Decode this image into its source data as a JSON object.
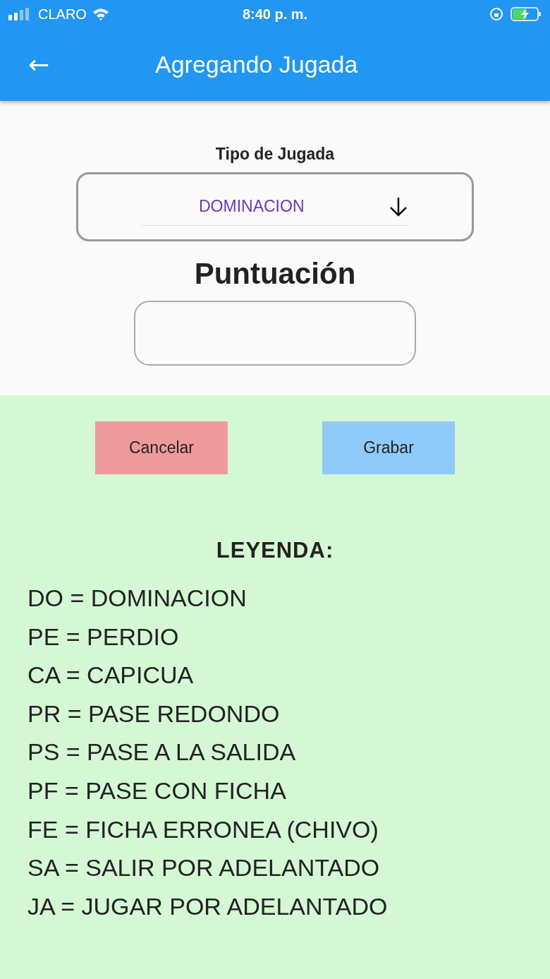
{
  "status_bar": {
    "carrier": "CLARO",
    "time": "8:40 p. m."
  },
  "app_bar": {
    "back": "←",
    "title": "Agregando Jugada"
  },
  "form": {
    "type_label": "Tipo de Jugada",
    "type_value": "DOMINACION",
    "score_label": "Puntuación"
  },
  "buttons": [
    {
      "kind": "cancel",
      "label": "Cancelar"
    },
    {
      "kind": "save",
      "label": "Grabar"
    }
  ],
  "legend": {
    "title": "LEYENDA:",
    "items": [
      "DO = DOMINACION",
      "PE = PERDIO",
      "CA = CAPICUA",
      "PR = PASE REDONDO",
      "PS = PASE A LA SALIDA",
      "PF = PASE CON FICHA",
      "FE = FICHA ERRONEA (CHIVO)",
      "SA = SALIR POR ADELANTADO",
      "JA = JUGAR POR ADELANTADO"
    ]
  }
}
